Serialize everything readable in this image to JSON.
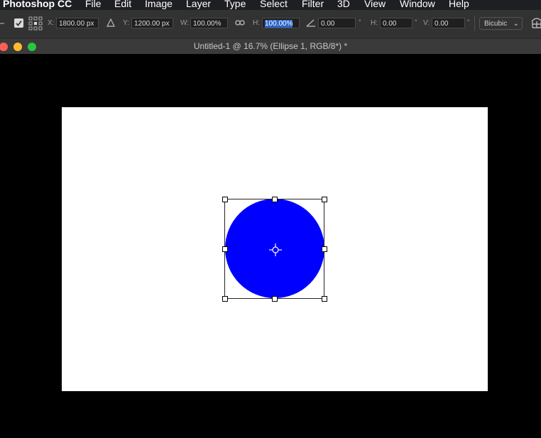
{
  "menubar": {
    "app_name": "Photoshop CC",
    "items": [
      "File",
      "Edit",
      "Image",
      "Layer",
      "Type",
      "Select",
      "Filter",
      "3D",
      "View",
      "Window",
      "Help"
    ]
  },
  "options": {
    "x_label": "X:",
    "x_value": "1800.00 px",
    "y_label": "Y:",
    "y_value": "1200.00 px",
    "w_label": "W:",
    "w_value": "100.00%",
    "h_label": "H:",
    "h_value": "100.00%",
    "angle_value": "0.00",
    "degree_symbol": "°",
    "hskew_label": "H:",
    "hskew_value": "0.00",
    "vskew_label": "V:",
    "vskew_value": "0.00",
    "interpolation": "Bicubic",
    "select_mode_checkbox": true
  },
  "document": {
    "title": "Untitled-1 @ 16.7% (Ellipse 1, RGB/8*) *",
    "shape_name": "Ellipse 1",
    "shape_fill": "#0000ff",
    "canvas_color": "#ffffff",
    "window_buttons": {
      "close": "#fe5f57",
      "minimize": "#febc2e",
      "zoom": "#28c840"
    }
  },
  "accent_color": "#2d64c8"
}
